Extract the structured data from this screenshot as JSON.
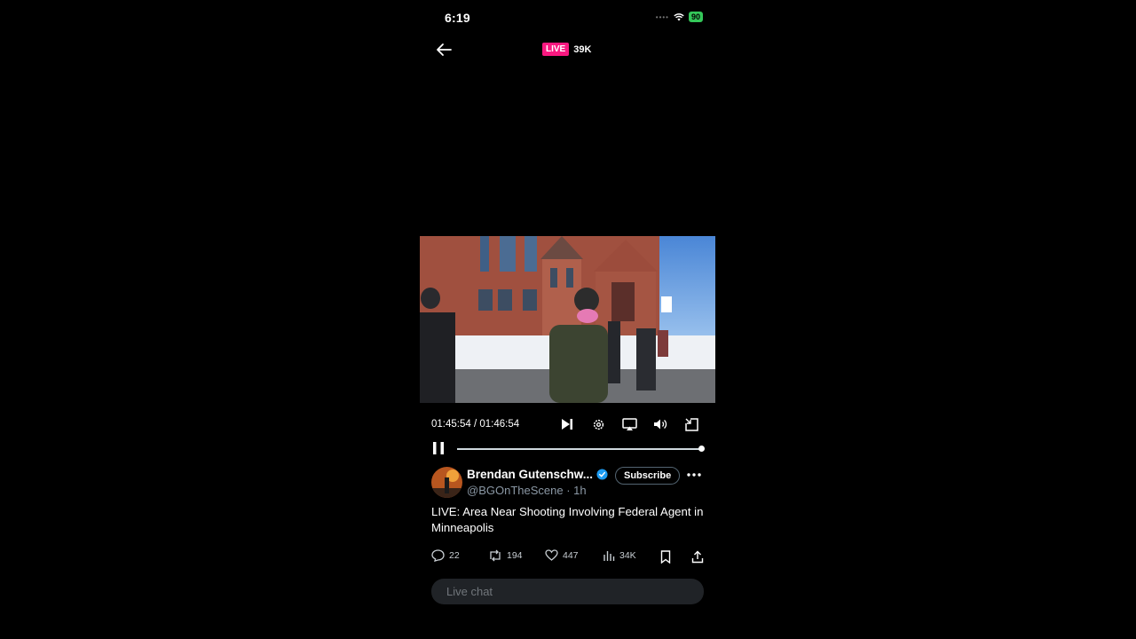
{
  "status_bar": {
    "time": "6:19",
    "battery": "90"
  },
  "top_bar": {
    "live_label": "LIVE",
    "viewers": "39K"
  },
  "player": {
    "timecode": "01:45:54 / 01:46:54",
    "progress": 1.0
  },
  "author": {
    "name": "Brendan Gutenschw...",
    "verified": true,
    "handle": "@BGOnTheScene",
    "age": "· 1h",
    "subscribe_label": "Subscribe"
  },
  "post": {
    "text": "LIVE: Area Near Shooting Involving Federal Agent in Minneapolis"
  },
  "actions": {
    "replies": "22",
    "reposts": "194",
    "likes": "447",
    "views": "34K"
  },
  "chat": {
    "placeholder": "Live chat"
  },
  "colors": {
    "live": "#f91880",
    "verified": "#1d9bf0",
    "battery": "#34c759"
  }
}
